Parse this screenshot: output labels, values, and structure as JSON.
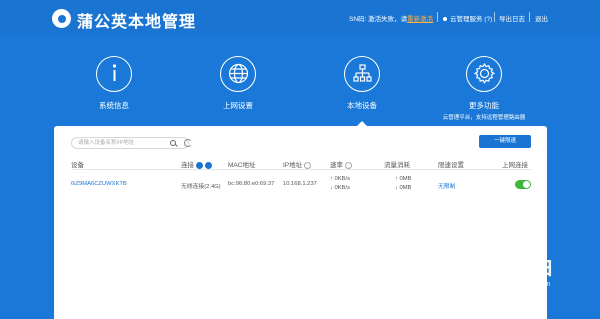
{
  "app": {
    "title": "蒲公英本地管理"
  },
  "header": {
    "sn_prefix": "SN码: 激活失败，请",
    "sn_link": "重新激活",
    "cloud": "云管理服务 (?)",
    "export": "导出日志",
    "logout": "退出"
  },
  "nav": [
    {
      "label": "系统信息"
    },
    {
      "label": "上网设置"
    },
    {
      "label": "本地设备"
    },
    {
      "label": "更多功能",
      "sub": "云管理平台，支持远程管理路由器"
    }
  ],
  "toolbar": {
    "search_placeholder": "请输入设备名称/IP地址",
    "onekey_label": "一键限速"
  },
  "table": {
    "headers": {
      "device": "设备",
      "conn": "连接",
      "mac": "MAC地址",
      "ip": "IP地址",
      "speed": "速率",
      "traffic": "流量消耗",
      "limit": "限速设置",
      "internet": "上网连接"
    },
    "rows": [
      {
        "device": "6iZ9MA6CZUWXKTB",
        "conn": "无线连接(2.4G)",
        "mac": "bc:96:80:e0:69:37",
        "ip": "10.168.1.237",
        "speed_up": "↑ 0KB/s",
        "speed_down": "↓ 0KB/s",
        "traffic_up": "↑ 0MB",
        "traffic_down": "↓ 0MB",
        "limit": "无限制"
      }
    ]
  },
  "watermark": {
    "text": "路由器",
    "url": "luyouqi.com"
  }
}
